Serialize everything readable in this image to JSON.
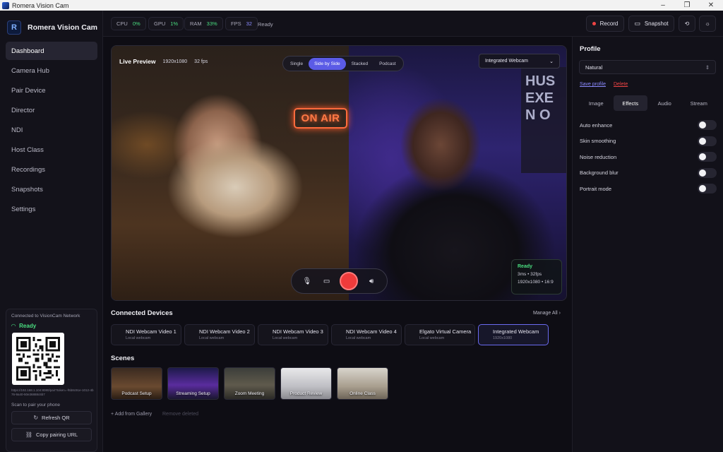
{
  "window": {
    "title": "Romera Vision Cam",
    "controls": [
      "–",
      "❐",
      "✕"
    ]
  },
  "brand": {
    "name": "Romera Vision Cam",
    "logo_letter": "R"
  },
  "nav": {
    "items": [
      "Dashboard",
      "Camera Hub",
      "Pair Device",
      "Director",
      "NDI",
      "Host Class",
      "Recordings",
      "Snapshots",
      "Settings"
    ],
    "active": "Dashboard"
  },
  "pairing": {
    "connected_to": "Connected to VisionCam Network",
    "status": "Ready",
    "url": "https://192.168.1.104:8080/pair?token=-f6b8c91e-1012-4b76-9a40-50e36888c6b7",
    "scan_hint": "Scan to pair your phone",
    "refresh_label": "Refresh QR",
    "copy_label": "Copy pairing URL"
  },
  "topbar": {
    "cpu_label": "CPU",
    "cpu_value": "0%",
    "gpu_label": "GPU",
    "gpu_value": "1%",
    "ram_label": "RAM",
    "ram_value": "33%",
    "fps_label": "FPS",
    "fps_value": "32",
    "status": "Ready",
    "record_label": "Record",
    "snapshot_label": "Snapshot",
    "colors": {
      "cpu": "#4ade80",
      "gpu": "#4ade80",
      "ram": "#4ade80",
      "fps": "#8b8bff"
    }
  },
  "preview": {
    "title": "Live Preview",
    "resolution": "1920x1080",
    "fps": "32 fps",
    "layouts": [
      "Single",
      "Side by Side",
      "Stacked",
      "Podcast"
    ],
    "active_layout": "Side by Side",
    "camera": "Integrated Webcam",
    "stats": {
      "status": "Ready",
      "latency": "3ms • 32fps",
      "format": "1920x1080 • 16:9"
    },
    "on_air": "ON AIR",
    "sign": "HUS\nEXE\nN O"
  },
  "devices": {
    "title": "Connected Devices",
    "manage_label": "Manage All ›",
    "items": [
      {
        "name": "NDI Webcam Video 1",
        "sub": "Local webcam"
      },
      {
        "name": "NDI Webcam Video 2",
        "sub": "Local webcam"
      },
      {
        "name": "NDI Webcam Video 3",
        "sub": "Local webcam"
      },
      {
        "name": "NDI Webcam Video 4",
        "sub": "Local webcam"
      },
      {
        "name": "Elgato Virtual Camera",
        "sub": "Local webcam"
      },
      {
        "name": "Integrated Webcam",
        "sub": "1920x1080"
      }
    ],
    "selected": "Integrated Webcam"
  },
  "scenes": {
    "title": "Scenes",
    "items": [
      "Podcast Setup",
      "Streaming Setup",
      "Zoom Meeting",
      "Product Review",
      "Online Class"
    ],
    "add_label": "+ Add from Gallery",
    "remove_label": "Remove deleted"
  },
  "profile": {
    "title": "Profile",
    "selected": "Natural",
    "save_label": "Save profile",
    "delete_label": "Delete",
    "tabs": [
      "Image",
      "Effects",
      "Audio",
      "Stream"
    ],
    "active_tab": "Effects",
    "effects": [
      {
        "name": "Auto enhance",
        "on": false
      },
      {
        "name": "Skin smoothing",
        "on": false
      },
      {
        "name": "Noise reduction",
        "on": false
      },
      {
        "name": "Background blur",
        "on": false
      },
      {
        "name": "Portrait mode",
        "on": false
      }
    ]
  }
}
